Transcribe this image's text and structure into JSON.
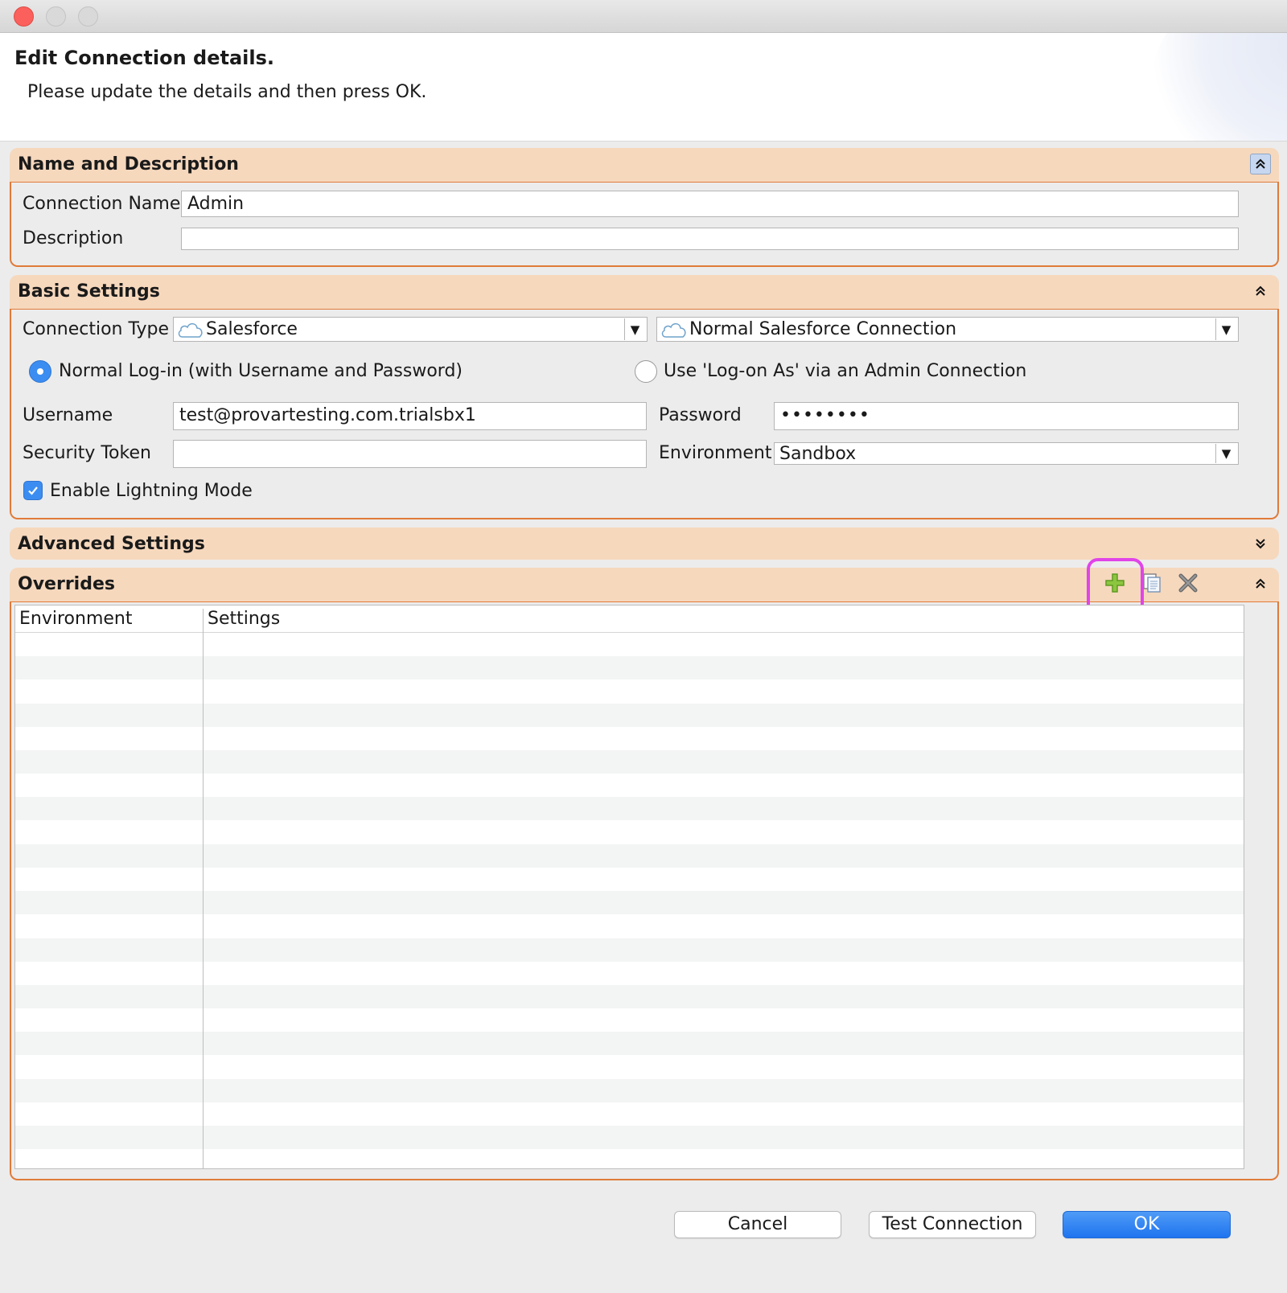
{
  "dialog": {
    "title": "Edit Connection details.",
    "subtitle": "Please update the details and then press OK."
  },
  "name_section": {
    "title": "Name and Description",
    "connection_name_label": "Connection Name",
    "connection_name_value": "Admin",
    "description_label": "Description",
    "description_value": ""
  },
  "basic_section": {
    "title": "Basic Settings",
    "connection_type_label": "Connection Type",
    "connection_type_value": "Salesforce",
    "connection_subtype_value": "Normal Salesforce Connection",
    "login_normal_label": "Normal Log-in (with Username and Password)",
    "login_admin_label": "Use 'Log-on As' via an Admin Connection",
    "selected_login": "normal",
    "username_label": "Username",
    "username_value": "test@provartesting.com.trialsbx1",
    "password_label": "Password",
    "password_value": "••••••••",
    "security_token_label": "Security Token",
    "security_token_value": "",
    "environment_label": "Environment",
    "environment_value": "Sandbox",
    "lightning_label": "Enable Lightning Mode",
    "lightning_checked": true
  },
  "advanced_section": {
    "title": "Advanced Settings",
    "collapsed": true
  },
  "overrides_section": {
    "title": "Overrides",
    "toolbar": [
      "add-icon",
      "copy-icon",
      "delete-icon"
    ],
    "columns": [
      "Environment",
      "Settings"
    ],
    "rows": []
  },
  "buttons": {
    "cancel": "Cancel",
    "test": "Test Connection",
    "ok": "OK"
  },
  "colors": {
    "section_header": "#f6d8bd",
    "section_border": "#e07b39",
    "accent": "#3b8df1",
    "highlight": "#e044e8"
  }
}
